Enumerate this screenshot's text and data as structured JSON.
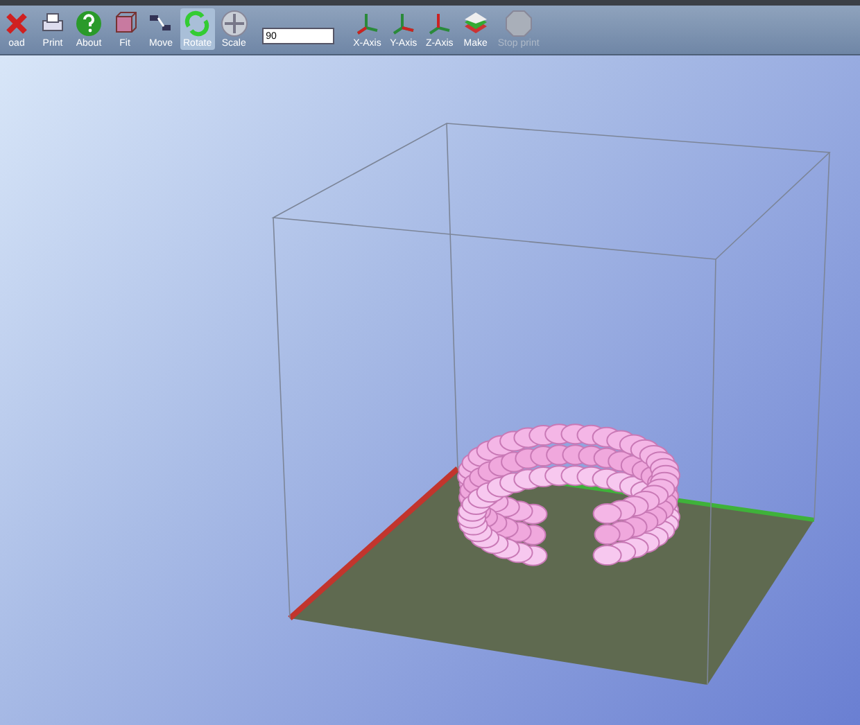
{
  "toolbar": {
    "items": [
      {
        "kind": "load",
        "label": "oad",
        "selected": false,
        "disabled": false
      },
      {
        "kind": "print",
        "label": "Print",
        "selected": false,
        "disabled": false
      },
      {
        "kind": "about",
        "label": "About",
        "selected": false,
        "disabled": false
      },
      {
        "kind": "fit",
        "label": "Fit",
        "selected": false,
        "disabled": false
      },
      {
        "kind": "move",
        "label": "Move",
        "selected": false,
        "disabled": false
      },
      {
        "kind": "rotate",
        "label": "Rotate",
        "selected": true,
        "disabled": false
      },
      {
        "kind": "scale",
        "label": "Scale",
        "selected": false,
        "disabled": false
      },
      {
        "kind": "field",
        "value": "90"
      },
      {
        "kind": "xaxis",
        "label": "X-Axis",
        "selected": false,
        "disabled": false
      },
      {
        "kind": "yaxis",
        "label": "Y-Axis",
        "selected": false,
        "disabled": false
      },
      {
        "kind": "zaxis",
        "label": "Z-Axis",
        "selected": false,
        "disabled": false
      },
      {
        "kind": "make",
        "label": "Make",
        "selected": false,
        "disabled": false
      },
      {
        "kind": "stop",
        "label": "Stop print",
        "selected": false,
        "disabled": true
      }
    ]
  }
}
